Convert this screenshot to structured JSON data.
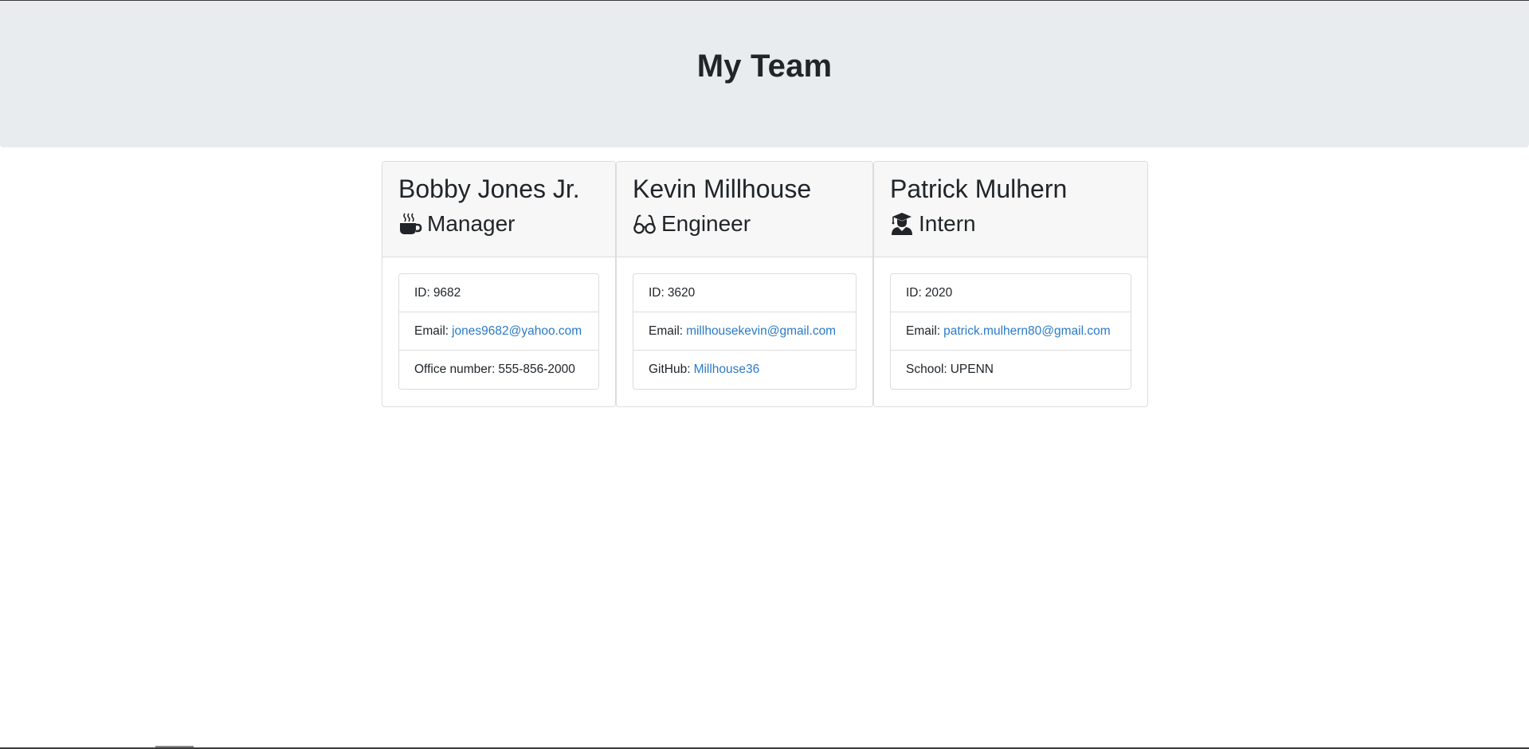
{
  "header": {
    "title": "My Team"
  },
  "cards": [
    {
      "name": "Bobby Jones Jr.",
      "role": "Manager",
      "icon": "coffee-icon",
      "id_label": "ID:",
      "id_value": "9682",
      "email_label": "Email:",
      "email_value": "jones9682@yahoo.com",
      "extra_label": "Office number:",
      "extra_value": "555-856-2000"
    },
    {
      "name": "Kevin Millhouse",
      "role": "Engineer",
      "icon": "glasses-icon",
      "id_label": "ID:",
      "id_value": "3620",
      "email_label": "Email:",
      "email_value": "millhousekevin@gmail.com",
      "extra_label": "GitHub:",
      "extra_value": "Millhouse36"
    },
    {
      "name": "Patrick Mulhern",
      "role": "Intern",
      "icon": "graduate-icon",
      "id_label": "ID:",
      "id_value": "2020",
      "email_label": "Email:",
      "email_value": "patrick.mulhern80@gmail.com",
      "extra_label": "School:",
      "extra_value": "UPENN"
    }
  ],
  "colors": {
    "header_bg": "#e9ecef",
    "link": "#2a7ac6",
    "card_header_bg": "#f7f7f7",
    "border": "#dcdcdc"
  }
}
